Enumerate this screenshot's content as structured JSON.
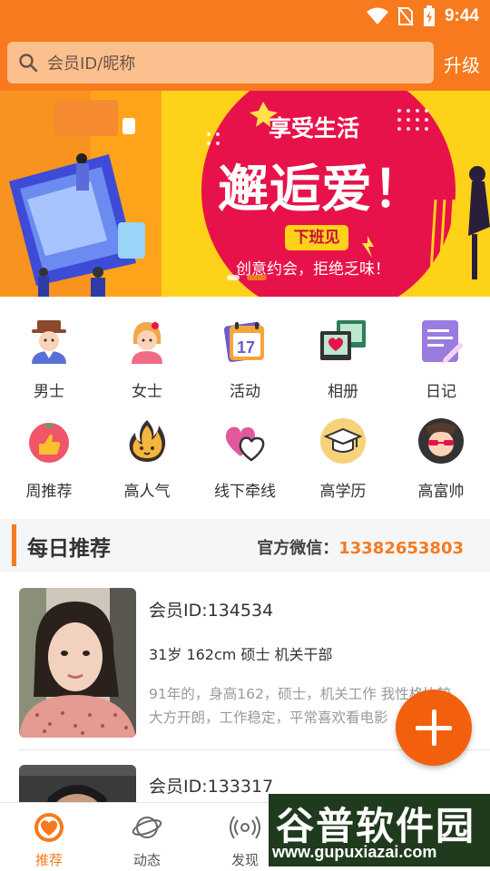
{
  "status": {
    "time": "9:44"
  },
  "header": {
    "search_placeholder": "会员ID/昵称",
    "upgrade_label": "升级"
  },
  "banner": {
    "tagline_top": "享受生活",
    "headline": "邂逅爱！",
    "badge": "下班见",
    "subline": "创意约会，拒绝乏味！"
  },
  "categories": [
    {
      "label": "男士",
      "icon": "man-icon"
    },
    {
      "label": "女士",
      "icon": "woman-icon"
    },
    {
      "label": "活动",
      "icon": "calendar-icon"
    },
    {
      "label": "相册",
      "icon": "photo-album-icon"
    },
    {
      "label": "日记",
      "icon": "diary-icon"
    },
    {
      "label": "周推荐",
      "icon": "thumbs-up-icon"
    },
    {
      "label": "高人气",
      "icon": "flame-icon"
    },
    {
      "label": "线下牵线",
      "icon": "hearts-icon"
    },
    {
      "label": "高学历",
      "icon": "graduation-cap-icon"
    },
    {
      "label": "高富帅",
      "icon": "cool-guy-icon"
    }
  ],
  "daily": {
    "title": "每日推荐",
    "wechat_label": "官方微信：",
    "wechat_value": "13382653803"
  },
  "members": [
    {
      "id_text": "会员ID:134534",
      "info": "31岁 162cm 硕士 机关干部",
      "desc_line1": "91年的，身高162，硕士，机关工作 我性格比较",
      "desc_line2": "大方开朗，工作稳定，平常喜欢看电影"
    },
    {
      "id_text": "会员ID:133317"
    }
  ],
  "nav": [
    {
      "label": "推荐",
      "icon": "heart-icon",
      "active": true
    },
    {
      "label": "动态",
      "icon": "planet-icon"
    },
    {
      "label": "发现",
      "icon": "radar-icon"
    }
  ],
  "watermark": {
    "brand": "谷普软件园",
    "url": "www.gupuxiazai.com"
  },
  "colors": {
    "accent": "#F77A1E",
    "search_bg": "#FBC08E",
    "banner_pink": "#E8124A",
    "fab": "#F2600D"
  }
}
